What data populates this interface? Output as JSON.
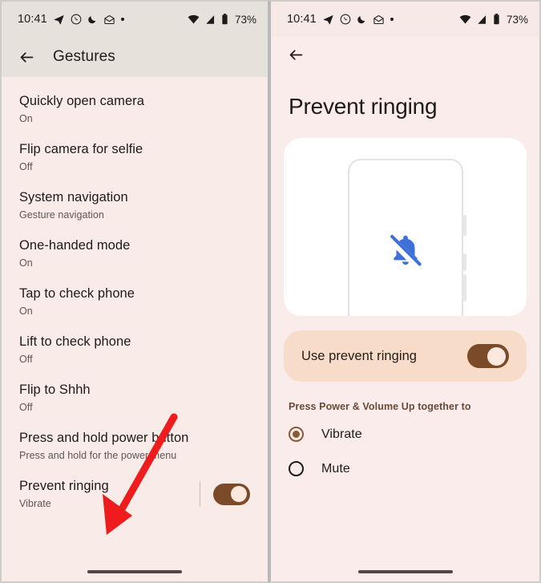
{
  "status_bar": {
    "time": "10:41",
    "battery_percent": "73%",
    "left_icons": [
      "telegram-icon",
      "whatsapp-icon",
      "moon-dnd-icon",
      "mail-icon",
      "dot-icon"
    ],
    "right_icons": [
      "wifi-icon",
      "cellular-signal-icon",
      "battery-icon"
    ]
  },
  "left_screen": {
    "app_bar": {
      "back_label": "back",
      "title": "Gestures"
    },
    "items": [
      {
        "title": "Quickly open camera",
        "subtitle": "On"
      },
      {
        "title": "Flip camera for selfie",
        "subtitle": "Off"
      },
      {
        "title": "System navigation",
        "subtitle": "Gesture navigation"
      },
      {
        "title": "One-handed mode",
        "subtitle": "On"
      },
      {
        "title": "Tap to check phone",
        "subtitle": "On"
      },
      {
        "title": "Lift to check phone",
        "subtitle": "Off"
      },
      {
        "title": "Flip to Shhh",
        "subtitle": "Off"
      },
      {
        "title": "Press and hold power button",
        "subtitle": "Press and hold for the power menu"
      },
      {
        "title": "Prevent ringing",
        "subtitle": "Vibrate",
        "toggle": "on"
      }
    ],
    "annotation": {
      "type": "arrow",
      "color": "#ee1c1c",
      "points_to": "Prevent ringing"
    }
  },
  "right_screen": {
    "app_bar": {
      "back_label": "back"
    },
    "page_title": "Prevent ringing",
    "illustration": {
      "name": "phone-with-bell-off-illustration",
      "bell_icon": "bell-off-icon",
      "bell_color": "#3f6fd8"
    },
    "toggle_pref": {
      "label": "Use prevent ringing",
      "state": "on"
    },
    "section_label": "Press Power & Volume Up together to",
    "radio_options": [
      {
        "label": "Vibrate",
        "selected": true
      },
      {
        "label": "Mute",
        "selected": false
      }
    ]
  },
  "colors": {
    "background_pink": "#f9ebe7",
    "app_bar_gray": "#e7e1dc",
    "toggle_on": "#7a4a29",
    "pref_card": "#f7dcc9",
    "accent_brown": "#8a5a33",
    "arrow_red": "#ee1c1c"
  }
}
